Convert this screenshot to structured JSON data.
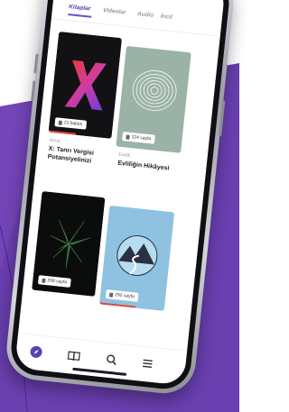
{
  "colors": {
    "accent": "#5b3fb3",
    "background_purple": "#6a3fb0"
  },
  "tabs": [
    {
      "label": "Kitaplar",
      "active": true
    },
    {
      "label": "Videolar",
      "active": false
    },
    {
      "label": "Audio",
      "active": false
    },
    {
      "label": "İncil",
      "active": false
    }
  ],
  "books": [
    {
      "category": "Amaç",
      "title": "X: Tanrı Vergisi Potansiyelinizi",
      "badge": "21 bölüm",
      "cover": "x-letter-cover",
      "accent": "#e8433a"
    },
    {
      "category": "Evlilik",
      "title": "Evliliğin Hikâyesi",
      "badge": "224 sayfa",
      "cover": "tree-rings-cover",
      "accent": "#e8433a"
    },
    {
      "category": "",
      "title": "",
      "badge": "268 sayfa",
      "cover": "green-leaves-cover",
      "accent": "#e8433a"
    },
    {
      "category": "",
      "title": "",
      "badge": "292 sayfa",
      "cover": "mountain-river-cover",
      "accent": "#e8433a"
    }
  ],
  "bottom_nav": [
    "compass-icon",
    "book-icon",
    "search-icon",
    "menu-icon"
  ]
}
